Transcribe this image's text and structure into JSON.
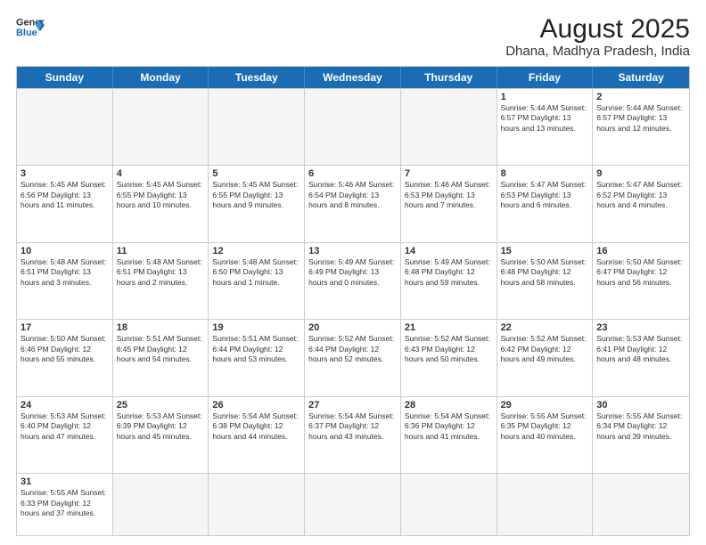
{
  "header": {
    "logo_general": "General",
    "logo_blue": "Blue",
    "month_title": "August 2025",
    "location": "Dhana, Madhya Pradesh, India"
  },
  "weekdays": [
    "Sunday",
    "Monday",
    "Tuesday",
    "Wednesday",
    "Thursday",
    "Friday",
    "Saturday"
  ],
  "weeks": [
    [
      {
        "day": "",
        "info": ""
      },
      {
        "day": "",
        "info": ""
      },
      {
        "day": "",
        "info": ""
      },
      {
        "day": "",
        "info": ""
      },
      {
        "day": "",
        "info": ""
      },
      {
        "day": "1",
        "info": "Sunrise: 5:44 AM\nSunset: 6:57 PM\nDaylight: 13 hours and 13 minutes."
      },
      {
        "day": "2",
        "info": "Sunrise: 5:44 AM\nSunset: 6:57 PM\nDaylight: 13 hours and 12 minutes."
      }
    ],
    [
      {
        "day": "3",
        "info": "Sunrise: 5:45 AM\nSunset: 6:56 PM\nDaylight: 13 hours and 11 minutes."
      },
      {
        "day": "4",
        "info": "Sunrise: 5:45 AM\nSunset: 6:55 PM\nDaylight: 13 hours and 10 minutes."
      },
      {
        "day": "5",
        "info": "Sunrise: 5:45 AM\nSunset: 6:55 PM\nDaylight: 13 hours and 9 minutes."
      },
      {
        "day": "6",
        "info": "Sunrise: 5:46 AM\nSunset: 6:54 PM\nDaylight: 13 hours and 8 minutes."
      },
      {
        "day": "7",
        "info": "Sunrise: 5:46 AM\nSunset: 6:53 PM\nDaylight: 13 hours and 7 minutes."
      },
      {
        "day": "8",
        "info": "Sunrise: 5:47 AM\nSunset: 6:53 PM\nDaylight: 13 hours and 6 minutes."
      },
      {
        "day": "9",
        "info": "Sunrise: 5:47 AM\nSunset: 6:52 PM\nDaylight: 13 hours and 4 minutes."
      }
    ],
    [
      {
        "day": "10",
        "info": "Sunrise: 5:48 AM\nSunset: 6:51 PM\nDaylight: 13 hours and 3 minutes."
      },
      {
        "day": "11",
        "info": "Sunrise: 5:48 AM\nSunset: 6:51 PM\nDaylight: 13 hours and 2 minutes."
      },
      {
        "day": "12",
        "info": "Sunrise: 5:48 AM\nSunset: 6:50 PM\nDaylight: 13 hours and 1 minute."
      },
      {
        "day": "13",
        "info": "Sunrise: 5:49 AM\nSunset: 6:49 PM\nDaylight: 13 hours and 0 minutes."
      },
      {
        "day": "14",
        "info": "Sunrise: 5:49 AM\nSunset: 6:48 PM\nDaylight: 12 hours and 59 minutes."
      },
      {
        "day": "15",
        "info": "Sunrise: 5:50 AM\nSunset: 6:48 PM\nDaylight: 12 hours and 58 minutes."
      },
      {
        "day": "16",
        "info": "Sunrise: 5:50 AM\nSunset: 6:47 PM\nDaylight: 12 hours and 56 minutes."
      }
    ],
    [
      {
        "day": "17",
        "info": "Sunrise: 5:50 AM\nSunset: 6:46 PM\nDaylight: 12 hours and 55 minutes."
      },
      {
        "day": "18",
        "info": "Sunrise: 5:51 AM\nSunset: 6:45 PM\nDaylight: 12 hours and 54 minutes."
      },
      {
        "day": "19",
        "info": "Sunrise: 5:51 AM\nSunset: 6:44 PM\nDaylight: 12 hours and 53 minutes."
      },
      {
        "day": "20",
        "info": "Sunrise: 5:52 AM\nSunset: 6:44 PM\nDaylight: 12 hours and 52 minutes."
      },
      {
        "day": "21",
        "info": "Sunrise: 5:52 AM\nSunset: 6:43 PM\nDaylight: 12 hours and 50 minutes."
      },
      {
        "day": "22",
        "info": "Sunrise: 5:52 AM\nSunset: 6:42 PM\nDaylight: 12 hours and 49 minutes."
      },
      {
        "day": "23",
        "info": "Sunrise: 5:53 AM\nSunset: 6:41 PM\nDaylight: 12 hours and 48 minutes."
      }
    ],
    [
      {
        "day": "24",
        "info": "Sunrise: 5:53 AM\nSunset: 6:40 PM\nDaylight: 12 hours and 47 minutes."
      },
      {
        "day": "25",
        "info": "Sunrise: 5:53 AM\nSunset: 6:39 PM\nDaylight: 12 hours and 45 minutes."
      },
      {
        "day": "26",
        "info": "Sunrise: 5:54 AM\nSunset: 6:38 PM\nDaylight: 12 hours and 44 minutes."
      },
      {
        "day": "27",
        "info": "Sunrise: 5:54 AM\nSunset: 6:37 PM\nDaylight: 12 hours and 43 minutes."
      },
      {
        "day": "28",
        "info": "Sunrise: 5:54 AM\nSunset: 6:36 PM\nDaylight: 12 hours and 41 minutes."
      },
      {
        "day": "29",
        "info": "Sunrise: 5:55 AM\nSunset: 6:35 PM\nDaylight: 12 hours and 40 minutes."
      },
      {
        "day": "30",
        "info": "Sunrise: 5:55 AM\nSunset: 6:34 PM\nDaylight: 12 hours and 39 minutes."
      }
    ],
    [
      {
        "day": "31",
        "info": "Sunrise: 5:55 AM\nSunset: 6:33 PM\nDaylight: 12 hours and 37 minutes."
      },
      {
        "day": "",
        "info": ""
      },
      {
        "day": "",
        "info": ""
      },
      {
        "day": "",
        "info": ""
      },
      {
        "day": "",
        "info": ""
      },
      {
        "day": "",
        "info": ""
      },
      {
        "day": "",
        "info": ""
      }
    ]
  ]
}
